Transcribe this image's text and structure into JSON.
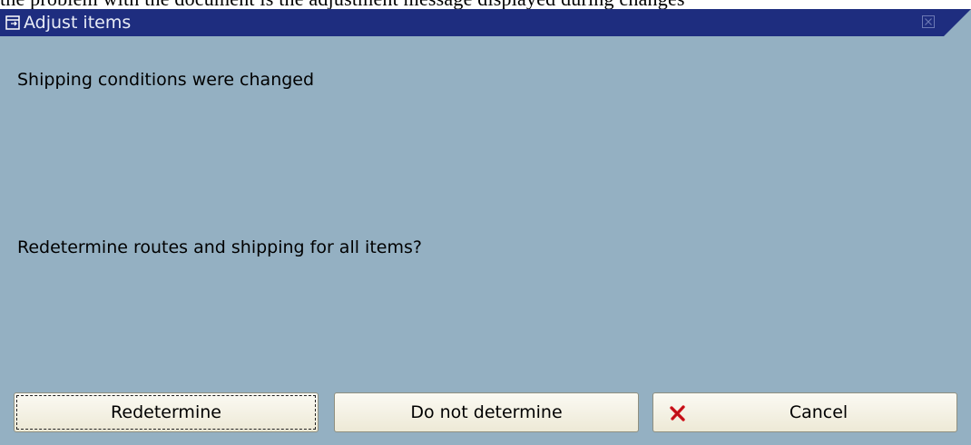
{
  "page_above": {
    "text": "the problem with the document is the adjustment message displayed during changes"
  },
  "dialog": {
    "title": "Adjust items",
    "message_1": "Shipping conditions were changed",
    "message_2": "Redetermine routes and shipping for all items?",
    "buttons": {
      "redetermine": "Redetermine",
      "do_not_determine": "Do not determine",
      "cancel": "Cancel"
    },
    "icons": {
      "title": "window-icon",
      "close": "close-icon",
      "cancel": "red-x-icon"
    },
    "colors": {
      "titlebar": "#1e2d7f",
      "body": "#94b0c2",
      "cancel_icon": "#d4141c"
    }
  }
}
